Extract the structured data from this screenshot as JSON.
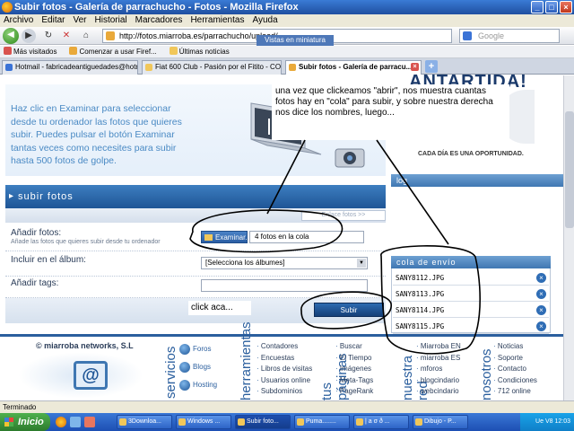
{
  "window": {
    "title": "Subir fotos - Galería de parrachucho - Fotos - Mozilla Firefox"
  },
  "menu": [
    "Archivo",
    "Editar",
    "Ver",
    "Historial",
    "Marcadores",
    "Herramientas",
    "Ayuda"
  ],
  "nav": {
    "url": "http://fotos.miarroba.es/parrachucho/upload/",
    "tooltip": "Vistas en miniatura",
    "search_placeholder": "Google"
  },
  "bookmarks": [
    {
      "label": "Más visitados",
      "color": "#d9534f"
    },
    {
      "label": "Comenzar a usar Firef...",
      "color": "#e9a93a"
    },
    {
      "label": "Últimas noticias",
      "color": "#f1c75a"
    }
  ],
  "tabs": [
    {
      "label": "Hotmail - fabricadeantiguedades@hotm...",
      "active": false
    },
    {
      "label": "Fiat 600 Club - Pasión por el Fitito - CO...",
      "active": false
    },
    {
      "label": "Subir fotos - Galería de parracu...",
      "active": true
    }
  ],
  "page": {
    "intro_text": "Haz clic en Examinar para seleccionar desde tu ordenador las fotos que quieres subir. Puedes pulsar el botón Examinar tantas veces como necesites para subir hasta 500 fotos de golpe.",
    "callout": "una vez que clickeamos \"abrir\", nos muestra cuantas fotos hay en \"cola\" para subir, y sobre nuestra derecha nos dice los nombres, luego...",
    "ad_title": "ANTARTIDA!",
    "ad_subtitle": "CADA DÍA ES UNA OPORTUNIDAD.",
    "sidebar_strip": "log",
    "section_title": "subir fotos",
    "help_link": "Enlace fotos >>",
    "form": {
      "add_label": "Añadir fotos:",
      "add_hint": "Añade las fotos que quieres subir desde tu ordenador",
      "browse_button": "Examinar...",
      "file_count": "4 fotos en la cola",
      "album_label": "Incluir en el álbum:",
      "album_value": "[Selecciona los álbumes]",
      "tags_label": "Añadir tags:",
      "click_note": "click aca...",
      "submit_button": "Subir"
    },
    "queue": {
      "title": "cola de envío",
      "items": [
        "SANY8112.JPG",
        "SANY8113.JPG",
        "SANY8114.JPG",
        "SANY8115.JPG"
      ]
    }
  },
  "footer": {
    "brand": "© miarroba networks, S.L",
    "services_label": "servicios",
    "services": [
      "Foros",
      "Blogs",
      "Hosting"
    ],
    "tools_label": "herramientas",
    "tools": [
      "Contadores",
      "Encuestas",
      "Libros de visitas",
      "Usuarios online",
      "Subdominios"
    ],
    "pages_label": "tus páginas",
    "pages": [
      "Buscar",
      "El Tiempo",
      "Imágenes",
      "Meta-Tags",
      "PageRank"
    ],
    "network_label": "nuestra red",
    "network": [
      "Miarroba EN",
      "miarroba ES",
      "mforos",
      "blogcindario",
      "webcindario"
    ],
    "us_label": "nosotros",
    "us": [
      "Noticias",
      "Soporte",
      "Contacto",
      "Condiciones",
      "712 online"
    ]
  },
  "status": "Terminado",
  "taskbar": {
    "start": "Inicio",
    "tasks": [
      {
        "label": "3Downloa...",
        "active": false
      },
      {
        "label": "Windows ...",
        "active": false
      },
      {
        "label": "Subir foto...",
        "active": true
      },
      {
        "label": "Puma........",
        "active": false
      },
      {
        "label": "| a σ ð ...",
        "active": false
      },
      {
        "label": "Dibujo - P...",
        "active": false
      }
    ],
    "clock": "12:03",
    "tray_text": "Ue V8"
  }
}
